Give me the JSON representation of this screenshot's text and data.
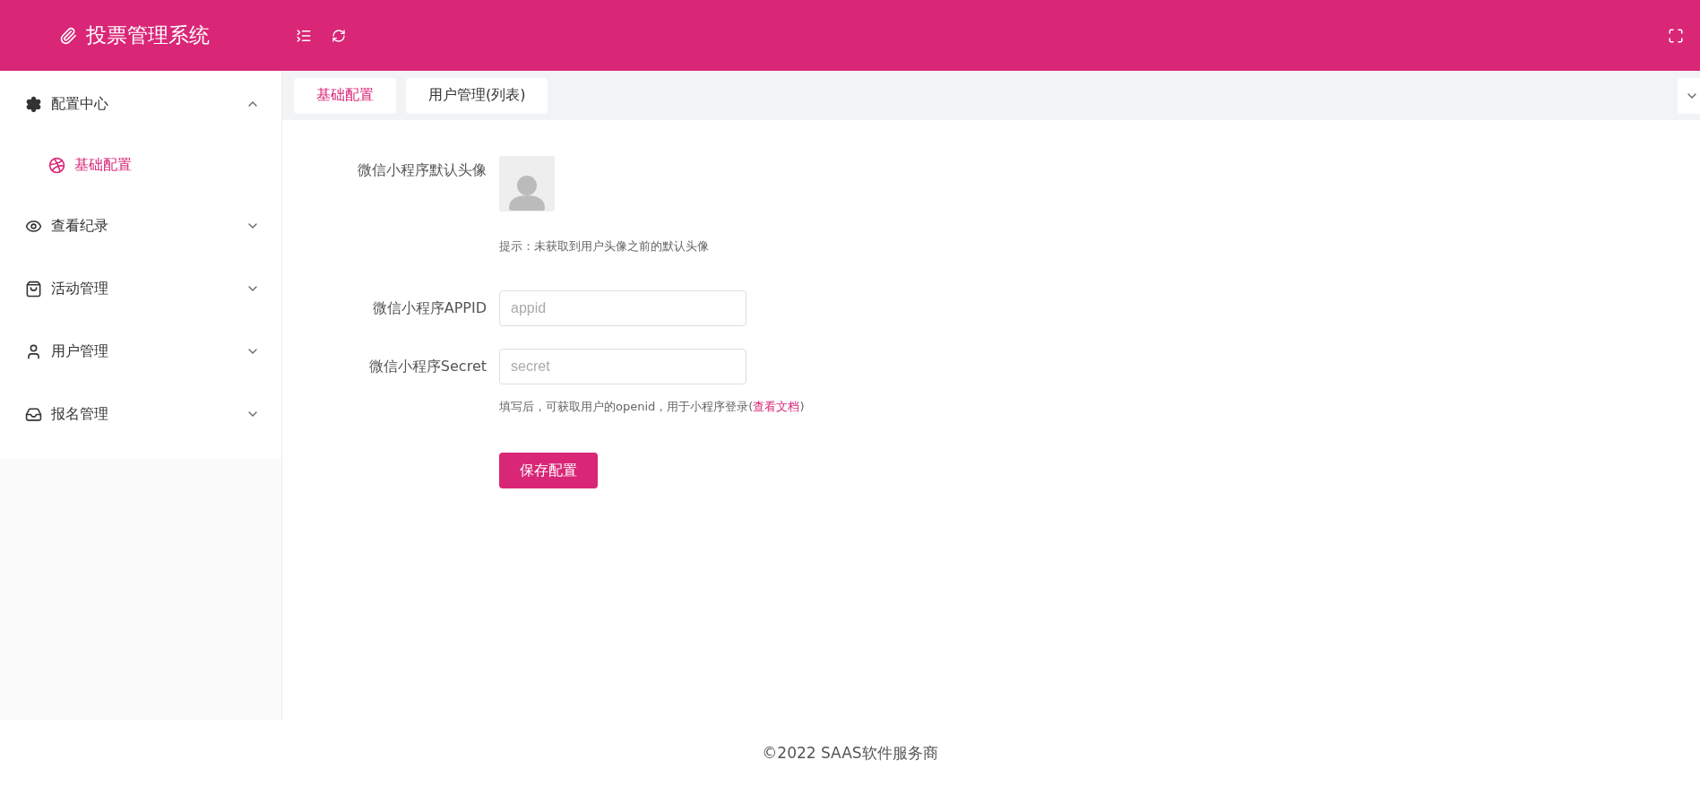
{
  "header": {
    "title": "投票管理系统"
  },
  "sidebar": {
    "items": [
      {
        "label": "配置中心",
        "expanded": true,
        "children": [
          {
            "label": "基础配置",
            "selected": true
          }
        ]
      },
      {
        "label": "查看纪录",
        "expanded": false
      },
      {
        "label": "活动管理",
        "expanded": false
      },
      {
        "label": "用户管理",
        "expanded": false
      },
      {
        "label": "报名管理",
        "expanded": false
      }
    ]
  },
  "tabs": [
    {
      "label": "基础配置",
      "selected": true
    },
    {
      "label": "用户管理(列表)",
      "selected": false
    }
  ],
  "form": {
    "fields": [
      {
        "kind": "avatar",
        "label": "微信小程序默认头像",
        "hint": "提示：未获取到用户头像之前的默认头像"
      },
      {
        "kind": "input",
        "label": "微信小程序APPID",
        "placeholder": "appid"
      },
      {
        "kind": "input",
        "label": "微信小程序Secret",
        "placeholder": "secret",
        "hint": "填写后，可获取用户的openid，用于小程序登录(",
        "link": "查看文档",
        "hint_end": ")"
      }
    ],
    "submit": "保存配置"
  },
  "footer": "©2022 SAAS软件服务商"
}
